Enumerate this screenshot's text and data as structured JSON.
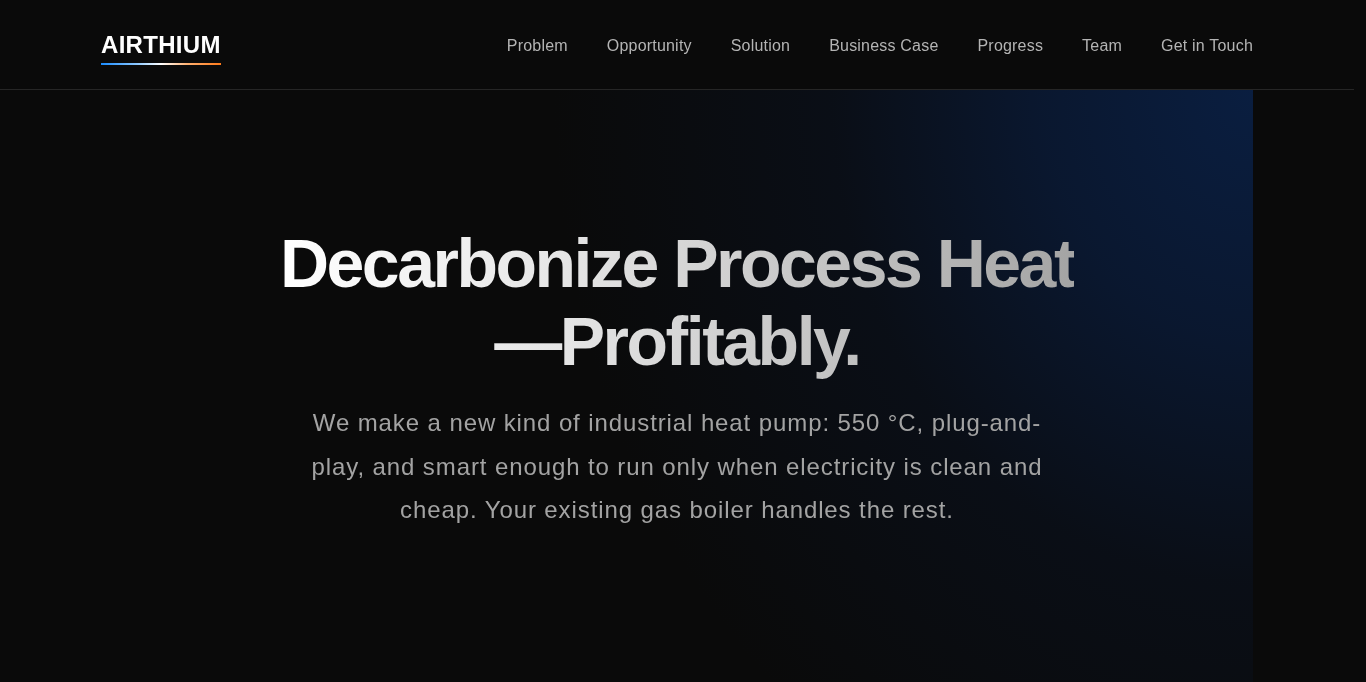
{
  "header": {
    "logo": "AIRTHIUM",
    "nav": [
      {
        "label": "Problem"
      },
      {
        "label": "Opportunity"
      },
      {
        "label": "Solution"
      },
      {
        "label": "Business Case"
      },
      {
        "label": "Progress"
      },
      {
        "label": "Team"
      },
      {
        "label": "Get in Touch"
      }
    ]
  },
  "hero": {
    "headline_lines": [
      "Decarbonize Process Heat",
      "—Profitably."
    ],
    "subheading": "We make a new kind of industrial heat pump: 550 °C, plug-and-play, and smart enough to run only when electricity is clean and cheap. Your existing gas boiler handles the rest."
  }
}
